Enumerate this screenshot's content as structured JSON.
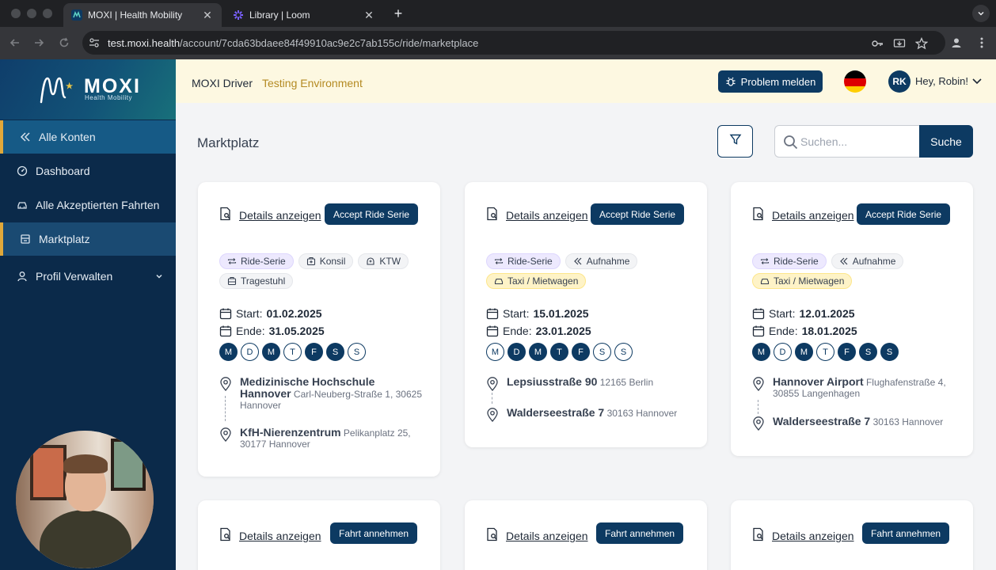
{
  "browser": {
    "tabs": [
      {
        "title": "MOXI | Health Mobility",
        "active": true
      },
      {
        "title": "Library | Loom",
        "active": false
      }
    ],
    "url_host": "test.moxi.health",
    "url_path": "/account/7cda63bdaee84f49910ac9e2c7ab155c/ride/marketplace"
  },
  "sidebar": {
    "logo_text": "MOXI",
    "logo_sub": "Health Mobility",
    "items": [
      {
        "label": "Alle Konten",
        "icon": "double-chevron-left-icon"
      },
      {
        "label": "Dashboard",
        "icon": "dashboard-icon"
      },
      {
        "label": "Alle Akzeptierten Fahrten",
        "icon": "car-icon"
      },
      {
        "label": "Marktplatz",
        "icon": "marketplace-icon"
      },
      {
        "label": "Profil Verwalten",
        "icon": "user-icon"
      }
    ]
  },
  "topbar": {
    "app_title": "MOXI Driver",
    "environment": "Testing Environment",
    "report_button": "Problem melden",
    "avatar_initials": "RK",
    "greeting": "Hey, Robin!",
    "accent": "#0d3a62"
  },
  "page": {
    "title": "Marktplatz",
    "search_placeholder": "Suchen...",
    "search_button": "Suche"
  },
  "cards": [
    {
      "details_label": "Details anzeigen",
      "action_label": "Accept Ride Serie",
      "tags": [
        "Ride-Serie",
        "Konsil",
        "KTW",
        "Tragestuhl"
      ],
      "start_label": "Start:",
      "start": "01.02.2025",
      "end_label": "Ende:",
      "end": "31.05.2025",
      "days": [
        {
          "l": "M",
          "on": true
        },
        {
          "l": "D",
          "on": false
        },
        {
          "l": "M",
          "on": true
        },
        {
          "l": "T",
          "on": false
        },
        {
          "l": "F",
          "on": true
        },
        {
          "l": "S",
          "on": true
        },
        {
          "l": "S",
          "on": false
        }
      ],
      "from_name": "Medizinische Hochschule Hannover",
      "from_addr": "Carl-Neuberg-Straße 1, 30625 Hannover",
      "to_name": "KfH-Nierenzentrum",
      "to_addr": "Pelikanplatz 25, 30177 Hannover"
    },
    {
      "details_label": "Details anzeigen",
      "action_label": "Accept Ride Serie",
      "tags": [
        "Ride-Serie",
        "Aufnahme",
        "Taxi / Mietwagen"
      ],
      "start_label": "Start:",
      "start": "15.01.2025",
      "end_label": "Ende:",
      "end": "23.01.2025",
      "days": [
        {
          "l": "M",
          "on": false
        },
        {
          "l": "D",
          "on": true
        },
        {
          "l": "M",
          "on": true
        },
        {
          "l": "T",
          "on": true
        },
        {
          "l": "F",
          "on": true
        },
        {
          "l": "S",
          "on": false
        },
        {
          "l": "S",
          "on": false
        }
      ],
      "from_name": "Lepsiusstraße 90",
      "from_addr": "12165 Berlin",
      "to_name": "Walderseestraße 7",
      "to_addr": "30163 Hannover"
    },
    {
      "details_label": "Details anzeigen",
      "action_label": "Accept Ride Serie",
      "tags": [
        "Ride-Serie",
        "Aufnahme",
        "Taxi / Mietwagen"
      ],
      "start_label": "Start:",
      "start": "12.01.2025",
      "end_label": "Ende:",
      "end": "18.01.2025",
      "days": [
        {
          "l": "M",
          "on": true
        },
        {
          "l": "D",
          "on": false
        },
        {
          "l": "M",
          "on": true
        },
        {
          "l": "T",
          "on": false
        },
        {
          "l": "F",
          "on": true
        },
        {
          "l": "S",
          "on": true
        },
        {
          "l": "S",
          "on": true
        }
      ],
      "from_name": "Hannover Airport",
      "from_addr": "Flughafenstraße 4, 30855 Langenhagen",
      "to_name": "Walderseestraße 7",
      "to_addr": "30163 Hannover"
    },
    {
      "details_label": "Details anzeigen",
      "action_label": "Fahrt annehmen"
    },
    {
      "details_label": "Details anzeigen",
      "action_label": "Fahrt annehmen"
    },
    {
      "details_label": "Details anzeigen",
      "action_label": "Fahrt annehmen"
    }
  ]
}
